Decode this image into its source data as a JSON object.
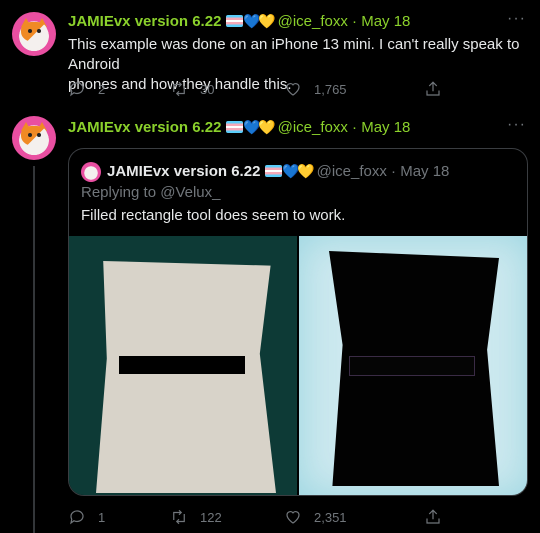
{
  "tweet1": {
    "name": "JAMIEvx version 6.22",
    "handle": "@ice_foxx",
    "separator": "·",
    "date": "May 18",
    "more": "···",
    "text_line1": "This example was done on an iPhone 13 mini. I can't really speak to Android",
    "text_line2": "phones and how they handle this.",
    "replies": "2",
    "retweets": "30",
    "likes": "1,765"
  },
  "tweet2": {
    "name": "JAMIEvx version 6.22",
    "handle": "@ice_foxx",
    "separator": "·",
    "date": "May 18",
    "more": "···",
    "replies": "1",
    "retweets": "122",
    "likes": "2,351",
    "quote": {
      "name": "JAMIEvx version 6.22",
      "handle": "@ice_foxx",
      "separator": "·",
      "date": "May 18",
      "replying_to": "Replying to @Velux_",
      "text": "Filled rectangle tool does seem to work."
    }
  },
  "icons": {
    "heart_blue": "💙",
    "heart_yellow": "💛"
  },
  "colors": {
    "name_green": "#8bd12c",
    "muted": "#71767b",
    "background": "#000000"
  }
}
